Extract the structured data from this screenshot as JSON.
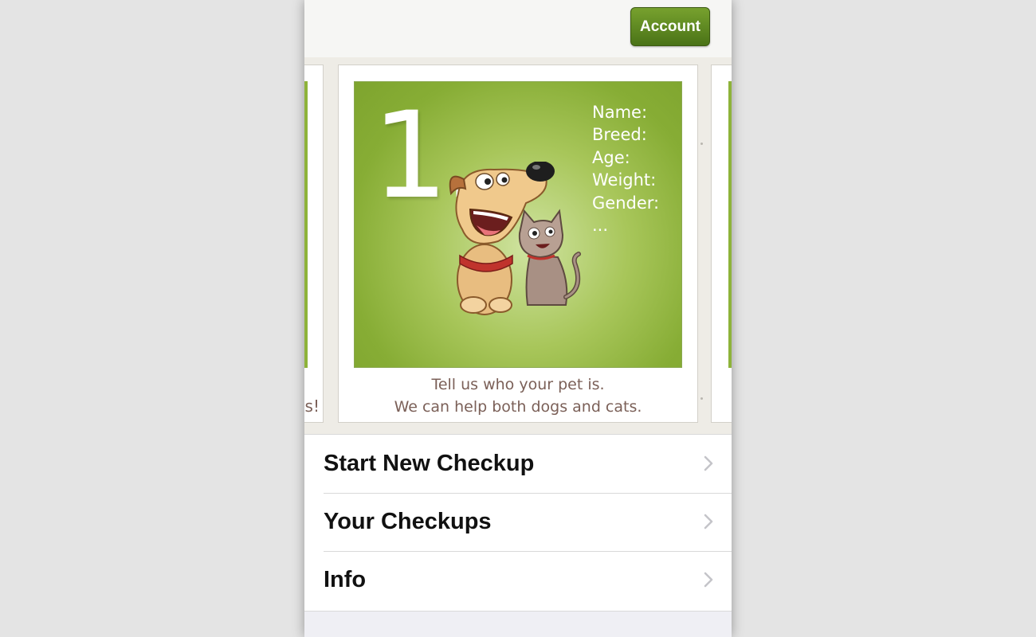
{
  "header": {
    "account_label": "Account"
  },
  "carousel": {
    "prev_card": {
      "caption_fragment": "os!"
    },
    "current_card": {
      "step_number": "1.",
      "fields": [
        "Name:",
        "Breed:",
        "Age:",
        "Weight:",
        "Gender:",
        "..."
      ],
      "caption_line1": "Tell us who your pet is.",
      "caption_line2": "We can help both dogs and cats."
    }
  },
  "menu": {
    "items": [
      {
        "label": "Start New Checkup",
        "icon": "chevron-right-icon"
      },
      {
        "label": "Your Checkups",
        "icon": "chevron-right-icon"
      },
      {
        "label": "Info",
        "icon": "chevron-right-icon"
      }
    ]
  },
  "colors": {
    "accent_green": "#5b8520",
    "image_green": "#8eb33a",
    "caption_brown": "#7b6058"
  }
}
